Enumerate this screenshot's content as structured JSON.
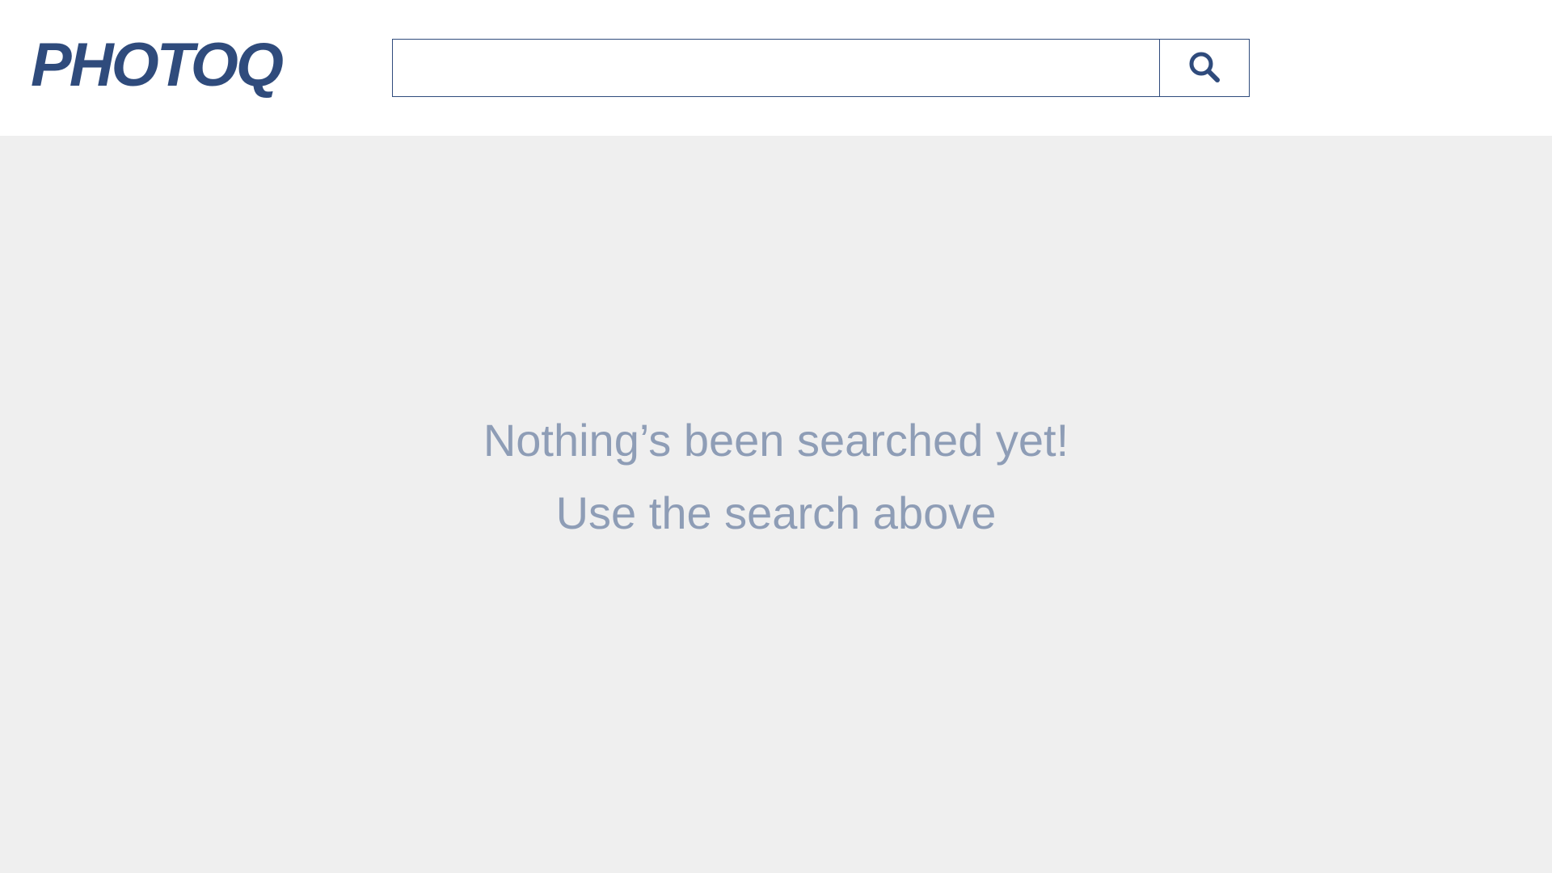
{
  "app": {
    "logo_text": "PHOTOQ",
    "brand_color": "#2f4b7c"
  },
  "search": {
    "value": "",
    "placeholder": "",
    "button_icon": "search-icon"
  },
  "empty_state": {
    "line1": "Nothing’s been searched yet!",
    "line2": "Use the search above",
    "text_color": "#8e9db6"
  },
  "colors": {
    "header_background": "#ffffff",
    "page_background": "#efefef"
  }
}
